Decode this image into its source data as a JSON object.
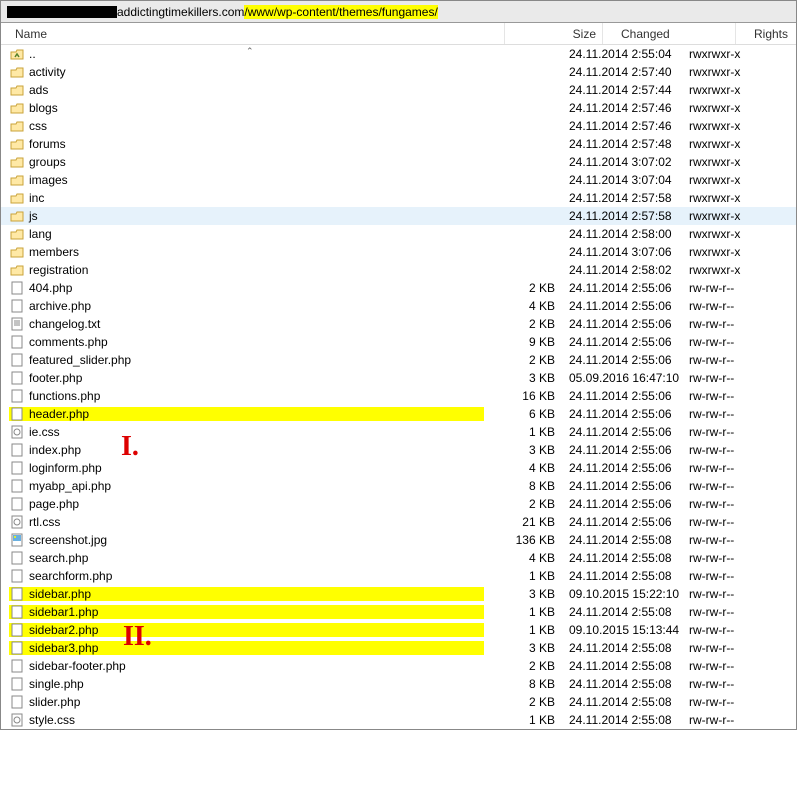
{
  "path": {
    "redacted_prefix": true,
    "plain": "addictingtimekillers.com",
    "highlighted": "/www/wp-content/themes/fungames/"
  },
  "columns": {
    "name": "Name",
    "size": "Size",
    "changed": "Changed",
    "rights": "Rights"
  },
  "markers": {
    "one": "I.",
    "two": "II."
  },
  "rows": [
    {
      "icon": "up",
      "name": "..",
      "size": "",
      "changed": "24.11.2014 2:55:04",
      "rights": "rwxrwxr-x"
    },
    {
      "icon": "folder",
      "name": "activity",
      "size": "",
      "changed": "24.11.2014 2:57:40",
      "rights": "rwxrwxr-x"
    },
    {
      "icon": "folder",
      "name": "ads",
      "size": "",
      "changed": "24.11.2014 2:57:44",
      "rights": "rwxrwxr-x"
    },
    {
      "icon": "folder",
      "name": "blogs",
      "size": "",
      "changed": "24.11.2014 2:57:46",
      "rights": "rwxrwxr-x"
    },
    {
      "icon": "folder",
      "name": "css",
      "size": "",
      "changed": "24.11.2014 2:57:46",
      "rights": "rwxrwxr-x"
    },
    {
      "icon": "folder",
      "name": "forums",
      "size": "",
      "changed": "24.11.2014 2:57:48",
      "rights": "rwxrwxr-x"
    },
    {
      "icon": "folder",
      "name": "groups",
      "size": "",
      "changed": "24.11.2014 3:07:02",
      "rights": "rwxrwxr-x"
    },
    {
      "icon": "folder",
      "name": "images",
      "size": "",
      "changed": "24.11.2014 3:07:04",
      "rights": "rwxrwxr-x"
    },
    {
      "icon": "folder",
      "name": "inc",
      "size": "",
      "changed": "24.11.2014 2:57:58",
      "rights": "rwxrwxr-x"
    },
    {
      "icon": "folder",
      "name": "js",
      "size": "",
      "changed": "24.11.2014 2:57:58",
      "rights": "rwxrwxr-x",
      "selected": true
    },
    {
      "icon": "folder",
      "name": "lang",
      "size": "",
      "changed": "24.11.2014 2:58:00",
      "rights": "rwxrwxr-x"
    },
    {
      "icon": "folder",
      "name": "members",
      "size": "",
      "changed": "24.11.2014 3:07:06",
      "rights": "rwxrwxr-x"
    },
    {
      "icon": "folder",
      "name": "registration",
      "size": "",
      "changed": "24.11.2014 2:58:02",
      "rights": "rwxrwxr-x"
    },
    {
      "icon": "file",
      "name": "404.php",
      "size": "2 KB",
      "changed": "24.11.2014 2:55:06",
      "rights": "rw-rw-r--"
    },
    {
      "icon": "file",
      "name": "archive.php",
      "size": "4 KB",
      "changed": "24.11.2014 2:55:06",
      "rights": "rw-rw-r--"
    },
    {
      "icon": "txt",
      "name": "changelog.txt",
      "size": "2 KB",
      "changed": "24.11.2014 2:55:06",
      "rights": "rw-rw-r--"
    },
    {
      "icon": "file",
      "name": "comments.php",
      "size": "9 KB",
      "changed": "24.11.2014 2:55:06",
      "rights": "rw-rw-r--"
    },
    {
      "icon": "file",
      "name": "featured_slider.php",
      "size": "2 KB",
      "changed": "24.11.2014 2:55:06",
      "rights": "rw-rw-r--"
    },
    {
      "icon": "file",
      "name": "footer.php",
      "size": "3 KB",
      "changed": "05.09.2016 16:47:10",
      "rights": "rw-rw-r--"
    },
    {
      "icon": "file",
      "name": "functions.php",
      "size": "16 KB",
      "changed": "24.11.2014 2:55:06",
      "rights": "rw-rw-r--"
    },
    {
      "icon": "file",
      "name": "header.php",
      "size": "6 KB",
      "changed": "24.11.2014 2:55:06",
      "rights": "rw-rw-r--",
      "hl": true
    },
    {
      "icon": "css",
      "name": "ie.css",
      "size": "1 KB",
      "changed": "24.11.2014 2:55:06",
      "rights": "rw-rw-r--"
    },
    {
      "icon": "file",
      "name": "index.php",
      "size": "3 KB",
      "changed": "24.11.2014 2:55:06",
      "rights": "rw-rw-r--"
    },
    {
      "icon": "file",
      "name": "loginform.php",
      "size": "4 KB",
      "changed": "24.11.2014 2:55:06",
      "rights": "rw-rw-r--"
    },
    {
      "icon": "file",
      "name": "myabp_api.php",
      "size": "8 KB",
      "changed": "24.11.2014 2:55:06",
      "rights": "rw-rw-r--"
    },
    {
      "icon": "file",
      "name": "page.php",
      "size": "2 KB",
      "changed": "24.11.2014 2:55:06",
      "rights": "rw-rw-r--"
    },
    {
      "icon": "css",
      "name": "rtl.css",
      "size": "21 KB",
      "changed": "24.11.2014 2:55:06",
      "rights": "rw-rw-r--"
    },
    {
      "icon": "img",
      "name": "screenshot.jpg",
      "size": "136 KB",
      "changed": "24.11.2014 2:55:08",
      "rights": "rw-rw-r--"
    },
    {
      "icon": "file",
      "name": "search.php",
      "size": "4 KB",
      "changed": "24.11.2014 2:55:08",
      "rights": "rw-rw-r--"
    },
    {
      "icon": "file",
      "name": "searchform.php",
      "size": "1 KB",
      "changed": "24.11.2014 2:55:08",
      "rights": "rw-rw-r--"
    },
    {
      "icon": "file",
      "name": "sidebar.php",
      "size": "3 KB",
      "changed": "09.10.2015 15:22:10",
      "rights": "rw-rw-r--",
      "hl": true
    },
    {
      "icon": "file",
      "name": "sidebar1.php",
      "size": "1 KB",
      "changed": "24.11.2014 2:55:08",
      "rights": "rw-rw-r--",
      "hl": true
    },
    {
      "icon": "file",
      "name": "sidebar2.php",
      "size": "1 KB",
      "changed": "09.10.2015 15:13:44",
      "rights": "rw-rw-r--",
      "hl": true
    },
    {
      "icon": "file",
      "name": "sidebar3.php",
      "size": "3 KB",
      "changed": "24.11.2014 2:55:08",
      "rights": "rw-rw-r--",
      "hl": true
    },
    {
      "icon": "file",
      "name": "sidebar-footer.php",
      "size": "2 KB",
      "changed": "24.11.2014 2:55:08",
      "rights": "rw-rw-r--"
    },
    {
      "icon": "file",
      "name": "single.php",
      "size": "8 KB",
      "changed": "24.11.2014 2:55:08",
      "rights": "rw-rw-r--"
    },
    {
      "icon": "file",
      "name": "slider.php",
      "size": "2 KB",
      "changed": "24.11.2014 2:55:08",
      "rights": "rw-rw-r--"
    },
    {
      "icon": "css",
      "name": "style.css",
      "size": "1 KB",
      "changed": "24.11.2014 2:55:08",
      "rights": "rw-rw-r--"
    }
  ]
}
